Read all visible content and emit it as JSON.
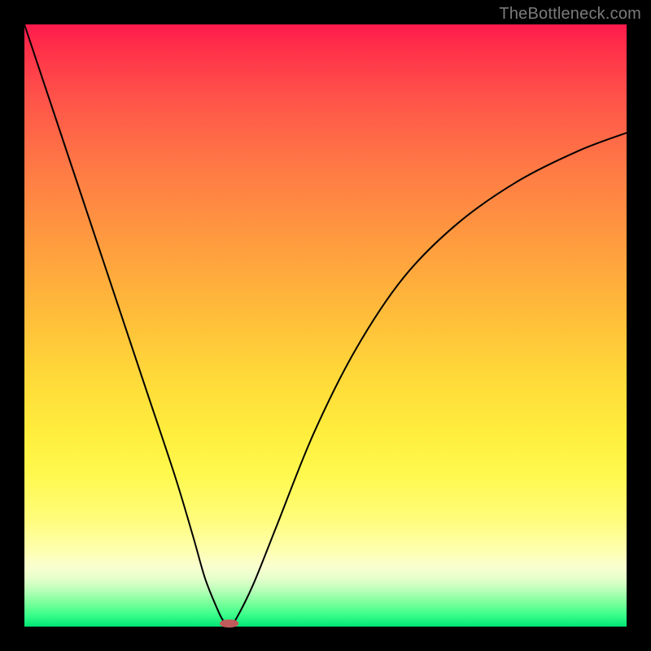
{
  "watermark": "TheBottleneck.com",
  "chart_data": {
    "type": "line",
    "title": "",
    "xlabel": "",
    "ylabel": "",
    "xlim": [
      0,
      100
    ],
    "ylim": [
      0,
      100
    ],
    "grid": false,
    "background_gradient": {
      "top": "#ff1a4d",
      "mid": "#ffee3d",
      "bottom": "#00e676"
    },
    "series": [
      {
        "name": "bottleneck-curve",
        "color": "#000000",
        "x": [
          0,
          5,
          10,
          15,
          20,
          25,
          28,
          30,
          32,
          33,
          34,
          35,
          38,
          42,
          48,
          55,
          63,
          72,
          82,
          92,
          100
        ],
        "values": [
          100,
          85,
          70,
          55,
          40,
          25,
          15,
          8,
          3,
          1,
          0,
          1,
          7,
          17,
          32,
          46,
          58,
          67,
          74,
          79,
          82
        ]
      }
    ],
    "markers": [
      {
        "name": "minimum-marker",
        "x": 34,
        "y": 0.5,
        "width_pct": 3.2,
        "height_pct": 1.3,
        "color": "#c15a5a"
      }
    ],
    "annotations": []
  }
}
